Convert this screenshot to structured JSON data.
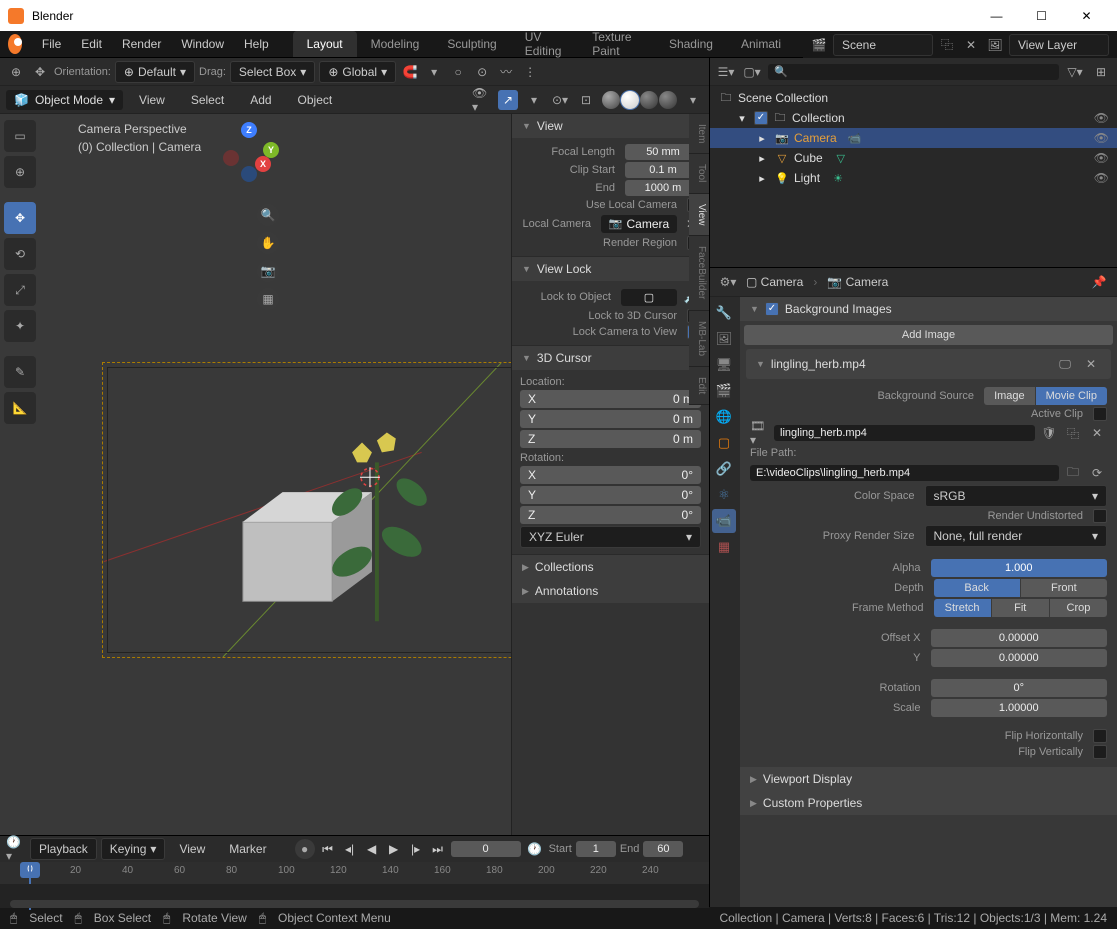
{
  "titlebar": {
    "title": "Blender"
  },
  "menu": {
    "file": "File",
    "edit": "Edit",
    "render": "Render",
    "window": "Window",
    "help": "Help"
  },
  "workspaces": [
    "Layout",
    "Modeling",
    "Sculpting",
    "UV Editing",
    "Texture Paint",
    "Shading",
    "Animati"
  ],
  "workspace_active": 0,
  "scene_header": {
    "scene_label": "Scene",
    "layer_label": "View Layer"
  },
  "toolbar": {
    "orientation_label": "Orientation:",
    "orientation_value": "Default",
    "drag_label": "Drag:",
    "drag_value": "Select Box",
    "transform_value": "Global"
  },
  "header": {
    "mode": "Object Mode",
    "view": "View",
    "select": "Select",
    "add": "Add",
    "object": "Object"
  },
  "viewport": {
    "title": "Camera Perspective",
    "subtitle": "(0) Collection | Camera"
  },
  "n_panel": {
    "tabs": [
      "Item",
      "Tool",
      "View",
      "FaceBuilder",
      "MB-Lab",
      "Edit"
    ],
    "view": {
      "title": "View",
      "focal_label": "Focal Length",
      "focal_value": "50 mm",
      "clip_start_label": "Clip Start",
      "clip_start_value": "0.1 m",
      "clip_end_label": "End",
      "clip_end_value": "1000 m",
      "use_local_label": "Use Local Camera",
      "local_camera_label": "Local Camera",
      "local_camera_value": "Camera",
      "render_region_label": "Render Region"
    },
    "view_lock": {
      "title": "View Lock",
      "lock_object_label": "Lock to Object",
      "lock_3d_label": "Lock to 3D Cursor",
      "lock_camera_label": "Lock Camera to View"
    },
    "cursor": {
      "title": "3D Cursor",
      "location_label": "Location:",
      "rotation_label": "Rotation:",
      "x": "X",
      "y": "Y",
      "z": "Z",
      "loc_val": "0 m",
      "rot_val": "0°",
      "euler": "XYZ Euler"
    },
    "collections": "Collections",
    "annotations": "Annotations"
  },
  "outliner": {
    "scene_collection": "Scene Collection",
    "collection": "Collection",
    "items": [
      {
        "name": "Camera",
        "icon": "camera",
        "selected": true
      },
      {
        "name": "Cube",
        "icon": "mesh",
        "selected": false
      },
      {
        "name": "Light",
        "icon": "light",
        "selected": false
      }
    ]
  },
  "properties": {
    "breadcrumb": [
      "Camera",
      "Camera"
    ],
    "bg_title": "Background Images",
    "add_image": "Add Image",
    "clip_name": "lingling_herb.mp4",
    "bg_source_label": "Background Source",
    "source_image": "Image",
    "source_movie": "Movie Clip",
    "active_clip_label": "Active Clip",
    "file_name": "lingling_herb.mp4",
    "file_path_label": "File Path:",
    "file_path": "E:\\videoClips\\lingling_herb.mp4",
    "color_space_label": "Color Space",
    "color_space_value": "sRGB",
    "render_undist_label": "Render Undistorted",
    "proxy_label": "Proxy Render Size",
    "proxy_value": "None, full render",
    "alpha_label": "Alpha",
    "alpha_value": "1.000",
    "depth_label": "Depth",
    "depth_back": "Back",
    "depth_front": "Front",
    "frame_method_label": "Frame Method",
    "fm_stretch": "Stretch",
    "fm_fit": "Fit",
    "fm_crop": "Crop",
    "offset_x_label": "Offset X",
    "offset_y_label": "Y",
    "offset_val": "0.00000",
    "rotation_label": "Rotation",
    "rotation_val": "0°",
    "scale_label": "Scale",
    "scale_val": "1.00000",
    "flip_h": "Flip Horizontally",
    "flip_v": "Flip Vertically",
    "viewport_display": "Viewport Display",
    "custom_props": "Custom Properties"
  },
  "timeline": {
    "playback": "Playback",
    "keying": "Keying",
    "view": "View",
    "marker": "Marker",
    "start_label": "Start",
    "start_val": "1",
    "end_label": "End",
    "end_val": "60",
    "current": "0",
    "ticks": [
      "20",
      "40",
      "60",
      "80",
      "100",
      "120",
      "140",
      "160",
      "180",
      "200",
      "220",
      "240"
    ]
  },
  "statusbar": {
    "select": "Select",
    "box_select": "Box Select",
    "rotate": "Rotate View",
    "context": "Object Context Menu",
    "right": "Collection | Camera | Verts:8 | Faces:6 | Tris:12 | Objects:1/3 | Mem: 1.24"
  }
}
